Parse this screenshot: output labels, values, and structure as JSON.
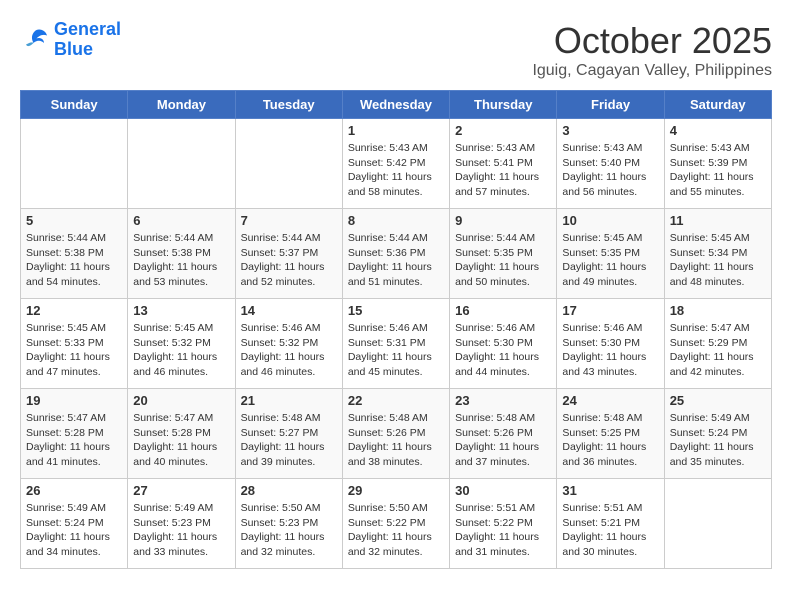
{
  "header": {
    "logo_line1": "General",
    "logo_line2": "Blue",
    "month": "October 2025",
    "location": "Iguig, Cagayan Valley, Philippines"
  },
  "days": [
    "Sunday",
    "Monday",
    "Tuesday",
    "Wednesday",
    "Thursday",
    "Friday",
    "Saturday"
  ],
  "weeks": [
    [
      {
        "date": "",
        "info": ""
      },
      {
        "date": "",
        "info": ""
      },
      {
        "date": "",
        "info": ""
      },
      {
        "date": "1",
        "info": "Sunrise: 5:43 AM\nSunset: 5:42 PM\nDaylight: 11 hours\nand 58 minutes."
      },
      {
        "date": "2",
        "info": "Sunrise: 5:43 AM\nSunset: 5:41 PM\nDaylight: 11 hours\nand 57 minutes."
      },
      {
        "date": "3",
        "info": "Sunrise: 5:43 AM\nSunset: 5:40 PM\nDaylight: 11 hours\nand 56 minutes."
      },
      {
        "date": "4",
        "info": "Sunrise: 5:43 AM\nSunset: 5:39 PM\nDaylight: 11 hours\nand 55 minutes."
      }
    ],
    [
      {
        "date": "5",
        "info": "Sunrise: 5:44 AM\nSunset: 5:38 PM\nDaylight: 11 hours\nand 54 minutes."
      },
      {
        "date": "6",
        "info": "Sunrise: 5:44 AM\nSunset: 5:38 PM\nDaylight: 11 hours\nand 53 minutes."
      },
      {
        "date": "7",
        "info": "Sunrise: 5:44 AM\nSunset: 5:37 PM\nDaylight: 11 hours\nand 52 minutes."
      },
      {
        "date": "8",
        "info": "Sunrise: 5:44 AM\nSunset: 5:36 PM\nDaylight: 11 hours\nand 51 minutes."
      },
      {
        "date": "9",
        "info": "Sunrise: 5:44 AM\nSunset: 5:35 PM\nDaylight: 11 hours\nand 50 minutes."
      },
      {
        "date": "10",
        "info": "Sunrise: 5:45 AM\nSunset: 5:35 PM\nDaylight: 11 hours\nand 49 minutes."
      },
      {
        "date": "11",
        "info": "Sunrise: 5:45 AM\nSunset: 5:34 PM\nDaylight: 11 hours\nand 48 minutes."
      }
    ],
    [
      {
        "date": "12",
        "info": "Sunrise: 5:45 AM\nSunset: 5:33 PM\nDaylight: 11 hours\nand 47 minutes."
      },
      {
        "date": "13",
        "info": "Sunrise: 5:45 AM\nSunset: 5:32 PM\nDaylight: 11 hours\nand 46 minutes."
      },
      {
        "date": "14",
        "info": "Sunrise: 5:46 AM\nSunset: 5:32 PM\nDaylight: 11 hours\nand 46 minutes."
      },
      {
        "date": "15",
        "info": "Sunrise: 5:46 AM\nSunset: 5:31 PM\nDaylight: 11 hours\nand 45 minutes."
      },
      {
        "date": "16",
        "info": "Sunrise: 5:46 AM\nSunset: 5:30 PM\nDaylight: 11 hours\nand 44 minutes."
      },
      {
        "date": "17",
        "info": "Sunrise: 5:46 AM\nSunset: 5:30 PM\nDaylight: 11 hours\nand 43 minutes."
      },
      {
        "date": "18",
        "info": "Sunrise: 5:47 AM\nSunset: 5:29 PM\nDaylight: 11 hours\nand 42 minutes."
      }
    ],
    [
      {
        "date": "19",
        "info": "Sunrise: 5:47 AM\nSunset: 5:28 PM\nDaylight: 11 hours\nand 41 minutes."
      },
      {
        "date": "20",
        "info": "Sunrise: 5:47 AM\nSunset: 5:28 PM\nDaylight: 11 hours\nand 40 minutes."
      },
      {
        "date": "21",
        "info": "Sunrise: 5:48 AM\nSunset: 5:27 PM\nDaylight: 11 hours\nand 39 minutes."
      },
      {
        "date": "22",
        "info": "Sunrise: 5:48 AM\nSunset: 5:26 PM\nDaylight: 11 hours\nand 38 minutes."
      },
      {
        "date": "23",
        "info": "Sunrise: 5:48 AM\nSunset: 5:26 PM\nDaylight: 11 hours\nand 37 minutes."
      },
      {
        "date": "24",
        "info": "Sunrise: 5:48 AM\nSunset: 5:25 PM\nDaylight: 11 hours\nand 36 minutes."
      },
      {
        "date": "25",
        "info": "Sunrise: 5:49 AM\nSunset: 5:24 PM\nDaylight: 11 hours\nand 35 minutes."
      }
    ],
    [
      {
        "date": "26",
        "info": "Sunrise: 5:49 AM\nSunset: 5:24 PM\nDaylight: 11 hours\nand 34 minutes."
      },
      {
        "date": "27",
        "info": "Sunrise: 5:49 AM\nSunset: 5:23 PM\nDaylight: 11 hours\nand 33 minutes."
      },
      {
        "date": "28",
        "info": "Sunrise: 5:50 AM\nSunset: 5:23 PM\nDaylight: 11 hours\nand 32 minutes."
      },
      {
        "date": "29",
        "info": "Sunrise: 5:50 AM\nSunset: 5:22 PM\nDaylight: 11 hours\nand 32 minutes."
      },
      {
        "date": "30",
        "info": "Sunrise: 5:51 AM\nSunset: 5:22 PM\nDaylight: 11 hours\nand 31 minutes."
      },
      {
        "date": "31",
        "info": "Sunrise: 5:51 AM\nSunset: 5:21 PM\nDaylight: 11 hours\nand 30 minutes."
      },
      {
        "date": "",
        "info": ""
      }
    ]
  ]
}
